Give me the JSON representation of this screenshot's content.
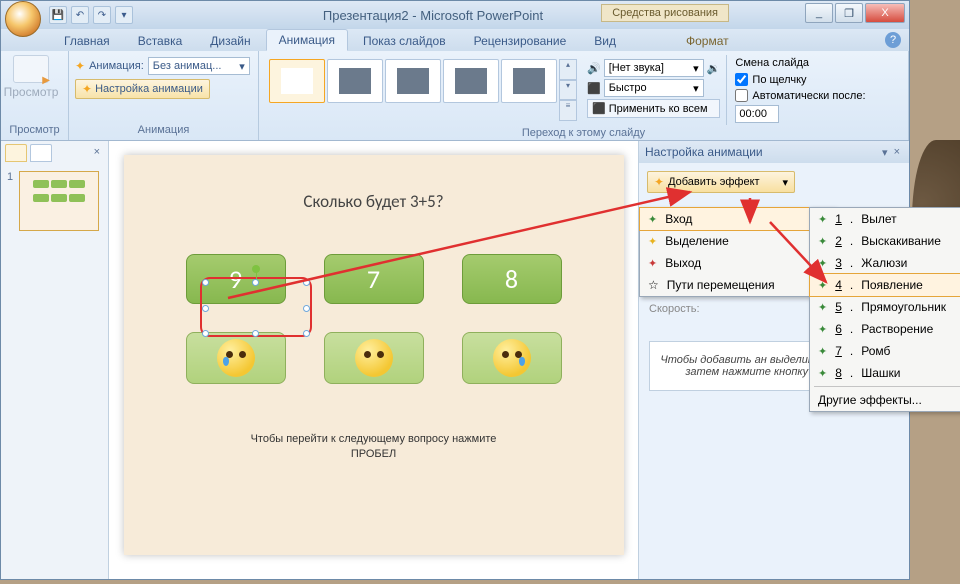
{
  "title": {
    "doc": "Презентация2",
    "app": "Microsoft PowerPoint",
    "context_tools": "Средства рисования"
  },
  "win_buttons": {
    "min": "_",
    "max": "❐",
    "close": "X"
  },
  "tabs": [
    "Главная",
    "Вставка",
    "Дизайн",
    "Анимация",
    "Показ слайдов",
    "Рецензирование",
    "Вид",
    "Формат"
  ],
  "ribbon": {
    "preview_label": "Просмотр",
    "preview_group": "Просмотр",
    "anim_label": "Анимация:",
    "anim_value": "Без анимац...",
    "settings_btn": "Настройка анимации",
    "anim_group": "Анимация",
    "transition_group": "Переход к этому слайду",
    "sound_label": "[Нет звука]",
    "speed_label": "Быстро",
    "apply_all": "Применить ко всем",
    "advance_title": "Смена слайда",
    "on_click": "По щелчку",
    "auto_after": "Автоматически после:",
    "auto_time": "00:00"
  },
  "thumb": {
    "num": "1"
  },
  "slide": {
    "question": "Сколько будет 3+5?",
    "answers": [
      "9",
      "7",
      "8"
    ],
    "hint1": "Чтобы перейти к следующему вопросу нажмите",
    "hint2": "ПРОБЕЛ"
  },
  "pane": {
    "title": "Настройка анимации",
    "add_effect": "Добавить эффект",
    "menu": [
      {
        "label": "Вход",
        "star": "green"
      },
      {
        "label": "Выделение",
        "star": "yellow"
      },
      {
        "label": "Выход",
        "star": "red"
      },
      {
        "label": "Пути перемещения",
        "star": "none"
      }
    ],
    "effects": [
      {
        "n": "1",
        "label": "Вылет"
      },
      {
        "n": "2",
        "label": "Выскакивание"
      },
      {
        "n": "3",
        "label": "Жалюзи"
      },
      {
        "n": "4",
        "label": "Появление"
      },
      {
        "n": "5",
        "label": "Прямоугольник"
      },
      {
        "n": "6",
        "label": "Растворение"
      },
      {
        "n": "7",
        "label": "Ромб"
      },
      {
        "n": "8",
        "label": "Шашки"
      }
    ],
    "more_effects": "Другие эффекты...",
    "speed": "Скорость:",
    "hint": "Чтобы добавить ан выделите элемент на затем нажмите кнопку эффект\"."
  }
}
